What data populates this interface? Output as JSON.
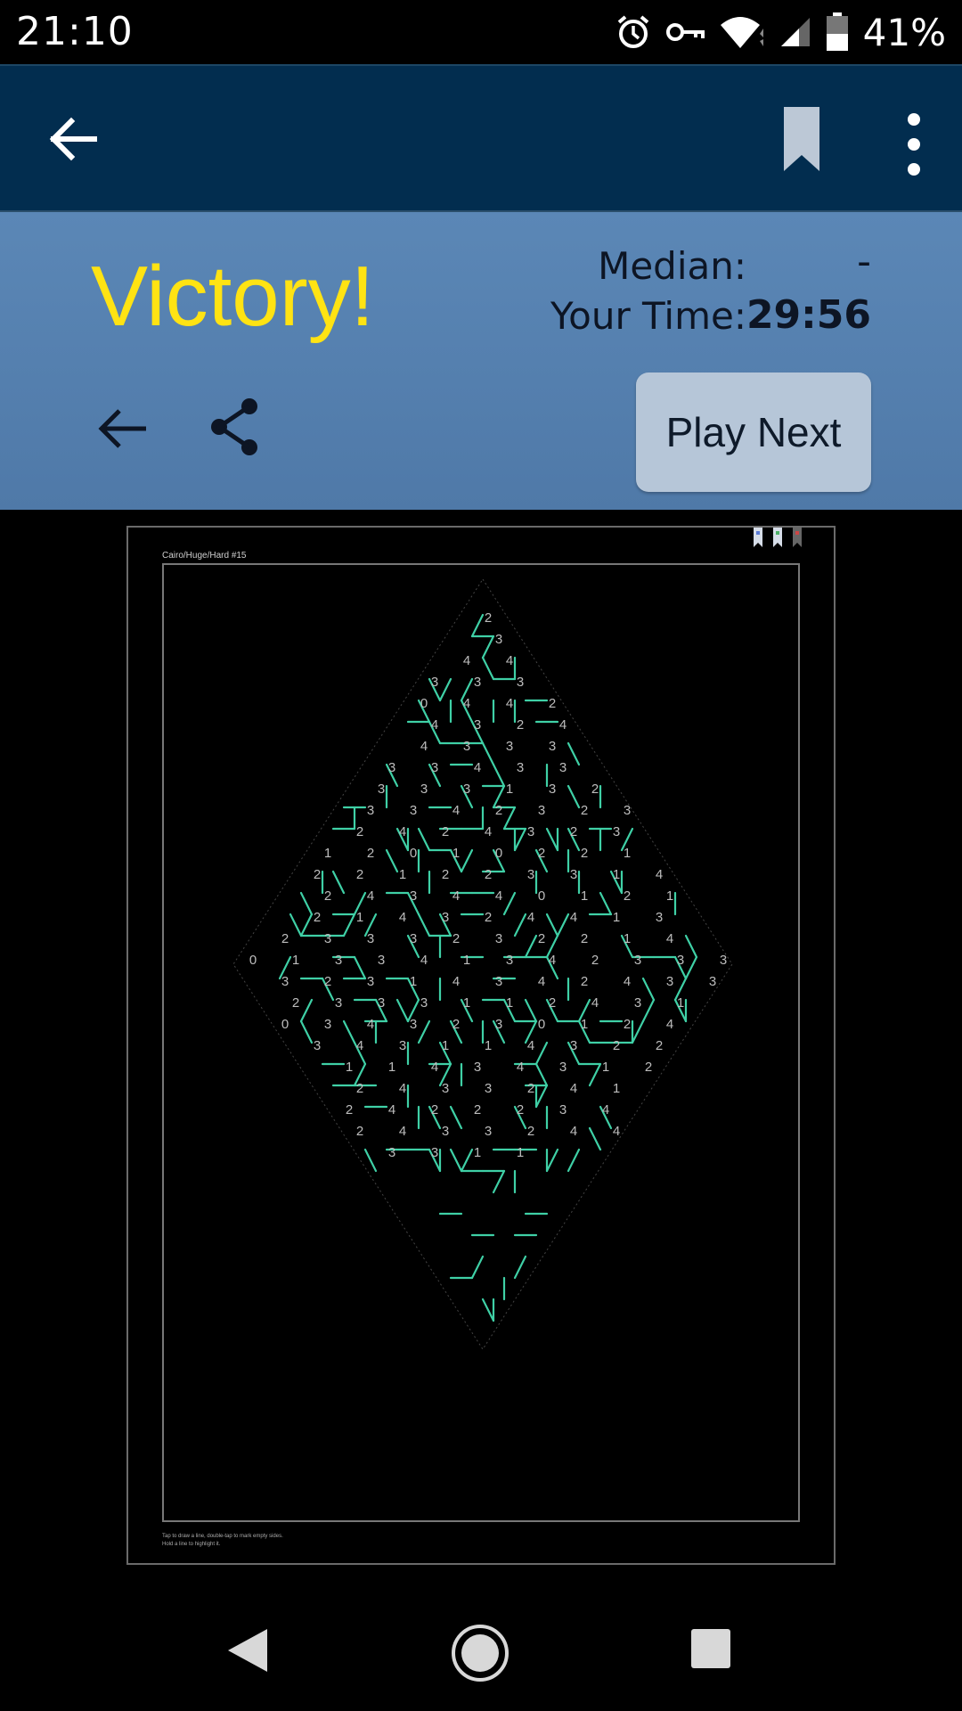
{
  "status_bar": {
    "time": "21:10",
    "battery_percent": "41%",
    "icons": [
      "alarm-icon",
      "vpn-key-icon",
      "wifi-icon",
      "cell-signal-icon",
      "battery-icon"
    ]
  },
  "app_bar": {
    "icons": [
      "arrow-back-icon",
      "bookmark-icon",
      "more-vert-icon"
    ],
    "colors": {
      "background": "#022d4f",
      "bookmark": "#bcc8d6"
    }
  },
  "result": {
    "headline": "Victory!",
    "median_label": "Median:",
    "median_value": "-",
    "time_label": "Your Time:",
    "time_value": "29:56",
    "play_next_label": "Play Next",
    "colors": {
      "headline": "#ffe313",
      "panel": "#5683b3",
      "button": "#b6c6d8"
    }
  },
  "puzzle": {
    "title": "Cairo/Huge/Hard #15",
    "help_line1": "Tap to draw a line, double-tap to mark empty sides.",
    "help_line2": "Hold a line to highlight it.",
    "line_color": "#3fd0a6",
    "clues": [
      "2",
      "3",
      "4",
      "4",
      "3",
      "3",
      "3",
      "0",
      "4",
      "4",
      "2",
      "4",
      "3",
      "2",
      "4",
      "4",
      "3",
      "3",
      "3",
      "3",
      "3",
      "4",
      "3",
      "3",
      "3",
      "3",
      "3",
      "1",
      "3",
      "2",
      "3",
      "3",
      "4",
      "2",
      "3",
      "2",
      "3",
      "2",
      "4",
      "2",
      "4",
      "3",
      "2",
      "3",
      "1",
      "2",
      "0",
      "1",
      "0",
      "2",
      "2",
      "1",
      "2",
      "2",
      "1",
      "2",
      "2",
      "3",
      "3",
      "1",
      "4",
      "2",
      "4",
      "3",
      "4",
      "4",
      "0",
      "1",
      "2",
      "1",
      "2",
      "1",
      "4",
      "3",
      "2",
      "4",
      "4",
      "1",
      "3",
      "2",
      "3",
      "3",
      "3",
      "2",
      "3",
      "2",
      "2",
      "1",
      "4",
      "0",
      "1",
      "3",
      "3",
      "4",
      "1",
      "3",
      "4",
      "2",
      "3",
      "3",
      "3",
      "3",
      "2",
      "3",
      "1",
      "4",
      "3",
      "4",
      "2",
      "4",
      "3",
      "3",
      "2",
      "3",
      "3",
      "3",
      "1",
      "1",
      "2",
      "4",
      "3",
      "1",
      "0",
      "3",
      "4",
      "3",
      "2",
      "3",
      "0",
      "1",
      "2",
      "4",
      "3",
      "4",
      "3",
      "1",
      "1",
      "4",
      "3",
      "2",
      "2",
      "1",
      "1",
      "4",
      "3",
      "4",
      "3",
      "1",
      "2",
      "2",
      "4",
      "3",
      "3",
      "2",
      "4",
      "1",
      "2",
      "4",
      "2",
      "2",
      "2",
      "3",
      "4",
      "2",
      "4",
      "3",
      "3",
      "2",
      "4",
      "4",
      "3",
      "3",
      "1",
      "1"
    ]
  },
  "nav_bar": {
    "icons": [
      "nav-back-icon",
      "nav-home-icon",
      "nav-recents-icon"
    ]
  }
}
